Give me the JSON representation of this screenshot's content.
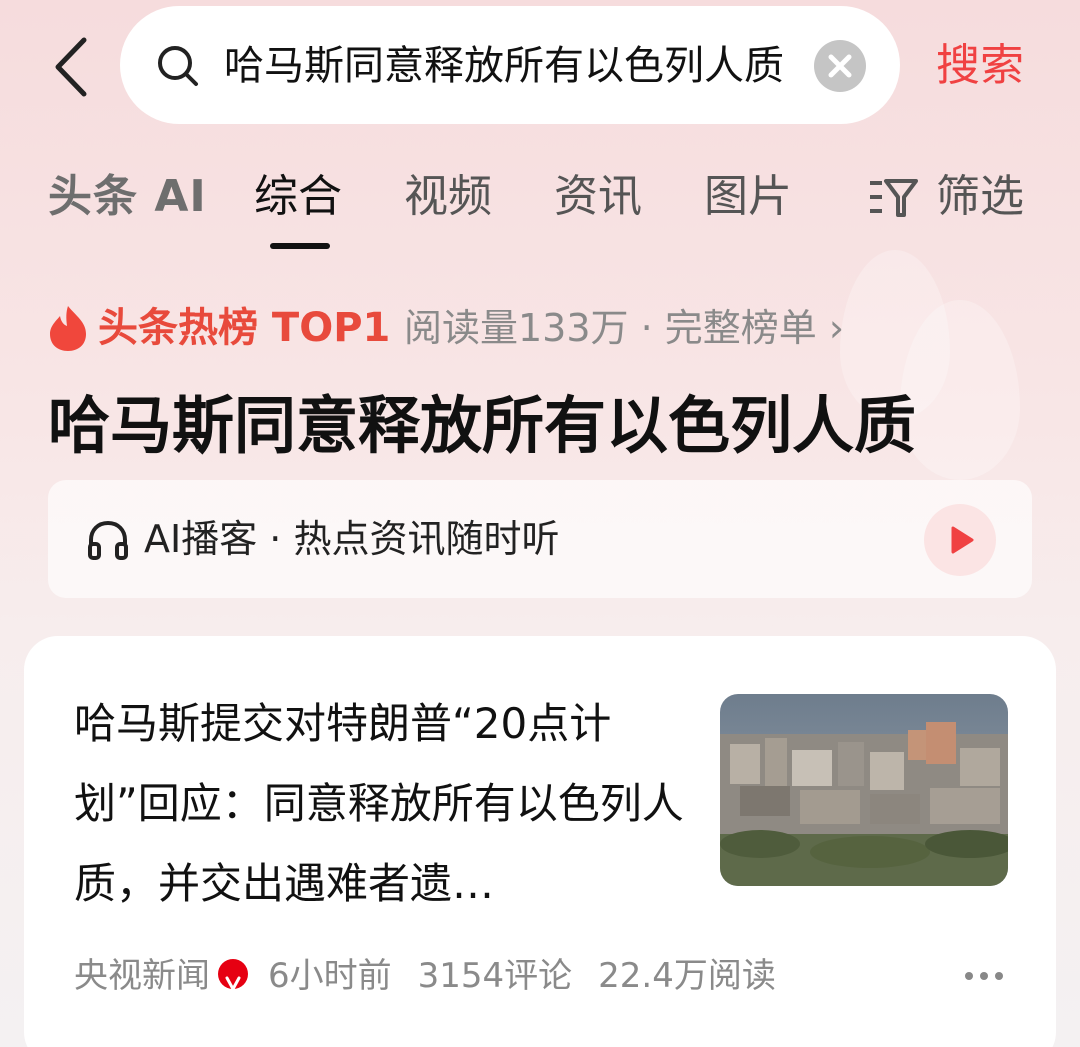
{
  "search": {
    "query": "哈马斯同意释放所有以色列人质",
    "submit_label": "搜索"
  },
  "tabs": {
    "ai_label": "头条 AI",
    "items": [
      {
        "label": "综合",
        "active": true
      },
      {
        "label": "视频",
        "active": false
      },
      {
        "label": "资讯",
        "active": false
      },
      {
        "label": "图片",
        "active": false
      }
    ],
    "filter_label": "筛选"
  },
  "hot": {
    "label": "头条热榜 TOP1",
    "meta": "阅读量133万 · 完整榜单 ›",
    "title": "哈马斯同意释放所有以色列人质"
  },
  "podcast": {
    "text": "AI播客 · 热点资讯随时听"
  },
  "news_card": {
    "title": "哈马斯提交对特朗普“20点计划”回应：同意释放所有以色列人质，并交出遇难者遗…",
    "source": "央视新闻",
    "time": "6小时前",
    "comments": "3154评论",
    "reads": "22.4万阅读"
  },
  "colors": {
    "accent": "#f04142",
    "hot": "#e84a3c"
  },
  "icons": [
    "back-arrow-icon",
    "search-icon",
    "clear-icon",
    "filter-icon",
    "flame-icon",
    "headphone-icon",
    "play-icon",
    "verified-icon",
    "more-icon"
  ]
}
